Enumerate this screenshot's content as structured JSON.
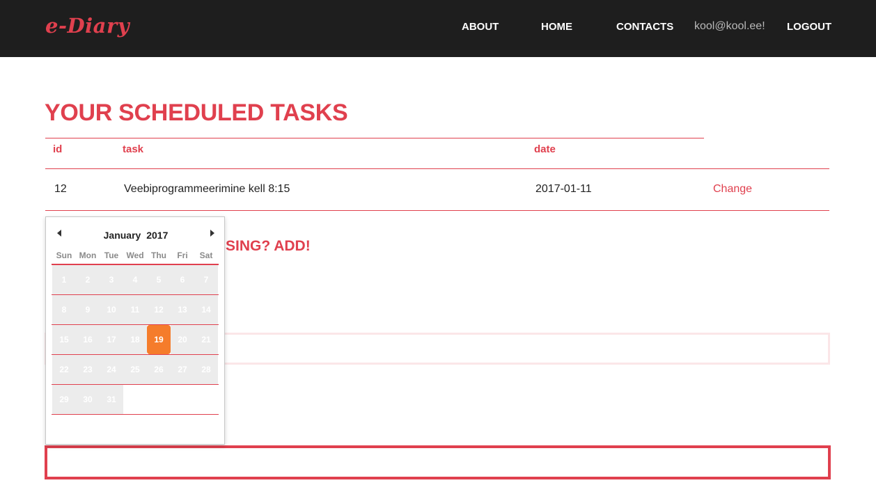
{
  "navbar": {
    "brand": "e-Diary",
    "links": {
      "about": "ABOUT",
      "home": "HOME",
      "contacts": "CONTACTS",
      "user": "kool@kool.ee!",
      "logout": "LOGOUT"
    }
  },
  "main": {
    "title": "YOUR SCHEDULED TASKS",
    "table": {
      "headers": [
        "id",
        "task",
        "date"
      ],
      "rows": [
        {
          "id": "12",
          "task": "Veebiprogrammeerimine kell 8:15",
          "date": "2017-01-11",
          "action": "Change"
        }
      ]
    },
    "add_heading_visible": "SSING? ADD!"
  },
  "datepicker": {
    "month": "January",
    "year": "2017",
    "weekdays": [
      "Sun",
      "Mon",
      "Tue",
      "Wed",
      "Thu",
      "Fri",
      "Sat"
    ],
    "days": [
      "1",
      "2",
      "3",
      "4",
      "5",
      "6",
      "7",
      "8",
      "9",
      "10",
      "11",
      "12",
      "13",
      "14",
      "15",
      "16",
      "17",
      "18",
      "19",
      "20",
      "21",
      "22",
      "23",
      "24",
      "25",
      "26",
      "27",
      "28",
      "29",
      "30",
      "31"
    ],
    "selected_day": "19"
  },
  "colors": {
    "accent": "#e0404e",
    "navbar_bg": "#1e1e1e",
    "selected_day": "#f57c2b"
  }
}
